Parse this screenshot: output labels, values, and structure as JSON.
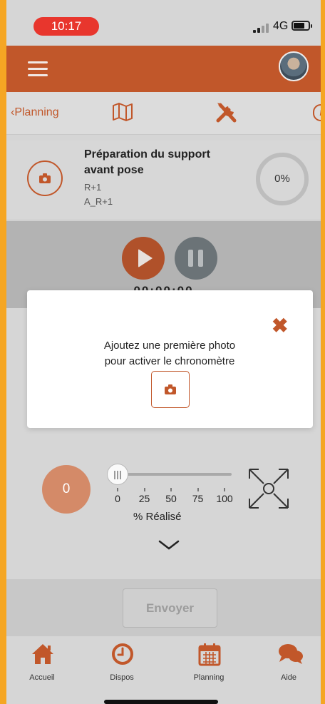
{
  "status_bar": {
    "time": "10:17",
    "network": "4G"
  },
  "top_nav": {
    "back_label": "Planning"
  },
  "task": {
    "title": "Préparation du support avant pose",
    "line1": "R+1",
    "line2": "A_R+1",
    "progress": "0%"
  },
  "timer": {
    "display": "00:00:00"
  },
  "modal": {
    "message_line1": "Ajoutez une première photo",
    "message_line2": "pour activer le chronomètre"
  },
  "percent": {
    "value": "0",
    "slider_value": 0,
    "ticks": [
      "0",
      "25",
      "50",
      "75",
      "100"
    ],
    "label": "% Réalisé"
  },
  "send_button": "Envoyer",
  "tabs": [
    {
      "label": "Accueil",
      "icon": "home-icon"
    },
    {
      "label": "Dispos",
      "icon": "clock-icon"
    },
    {
      "label": "Planning",
      "icon": "calendar-icon"
    },
    {
      "label": "Aide",
      "icon": "chat-icon"
    }
  ],
  "colors": {
    "accent": "#c1572a",
    "time_pill": "#e8362d"
  }
}
